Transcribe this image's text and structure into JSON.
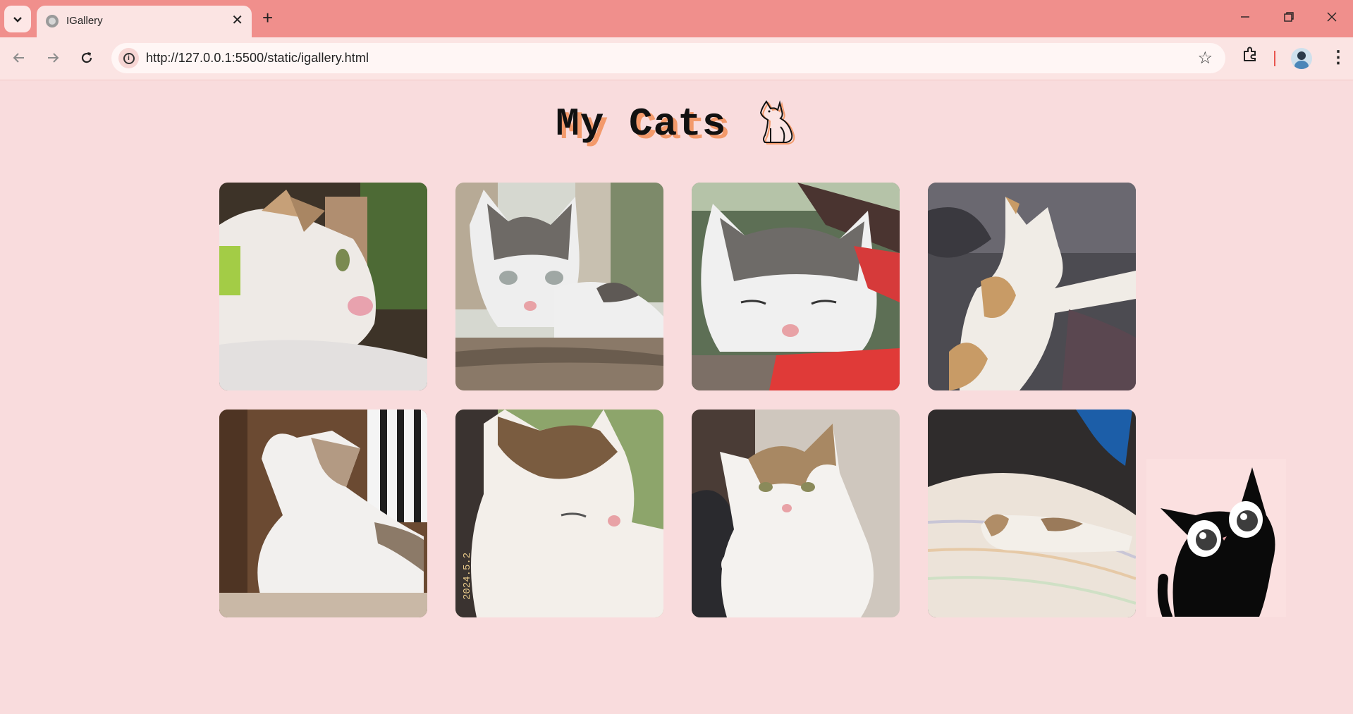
{
  "browser": {
    "tab_title": "IGallery",
    "url": "http://127.0.0.1:5500/static/igallery.html",
    "accent_color": "#f08f8c",
    "icons": [
      "tab-search-icon",
      "globe-icon",
      "close-icon",
      "plus-icon",
      "minimize-icon",
      "restore-icon",
      "window-close-icon",
      "back-icon",
      "forward-icon",
      "reload-icon",
      "info-icon",
      "star-icon",
      "extensions-icon",
      "profile-avatar",
      "more-icon"
    ]
  },
  "page": {
    "title": "My Cats",
    "title_icon": "cat-outline-icon",
    "background": "#f9dcdd",
    "title_shadow_color": "#f39a6b",
    "photos": [
      {
        "subject": "cat lying sideways close-up"
      },
      {
        "subject": "tabby-white cat lying on mat"
      },
      {
        "subject": "cat sleeping on red strap"
      },
      {
        "subject": "calico cat sleeping on dark cloth"
      },
      {
        "subject": "cat looking up by window"
      },
      {
        "subject": "cat with eyes closed outdoors"
      },
      {
        "subject": "cat sitting against wall"
      },
      {
        "subject": "cat sleeping on striped bedding"
      }
    ],
    "photo_caption_visible": "2024.5.2",
    "decoration": "black-cat-illustration"
  }
}
